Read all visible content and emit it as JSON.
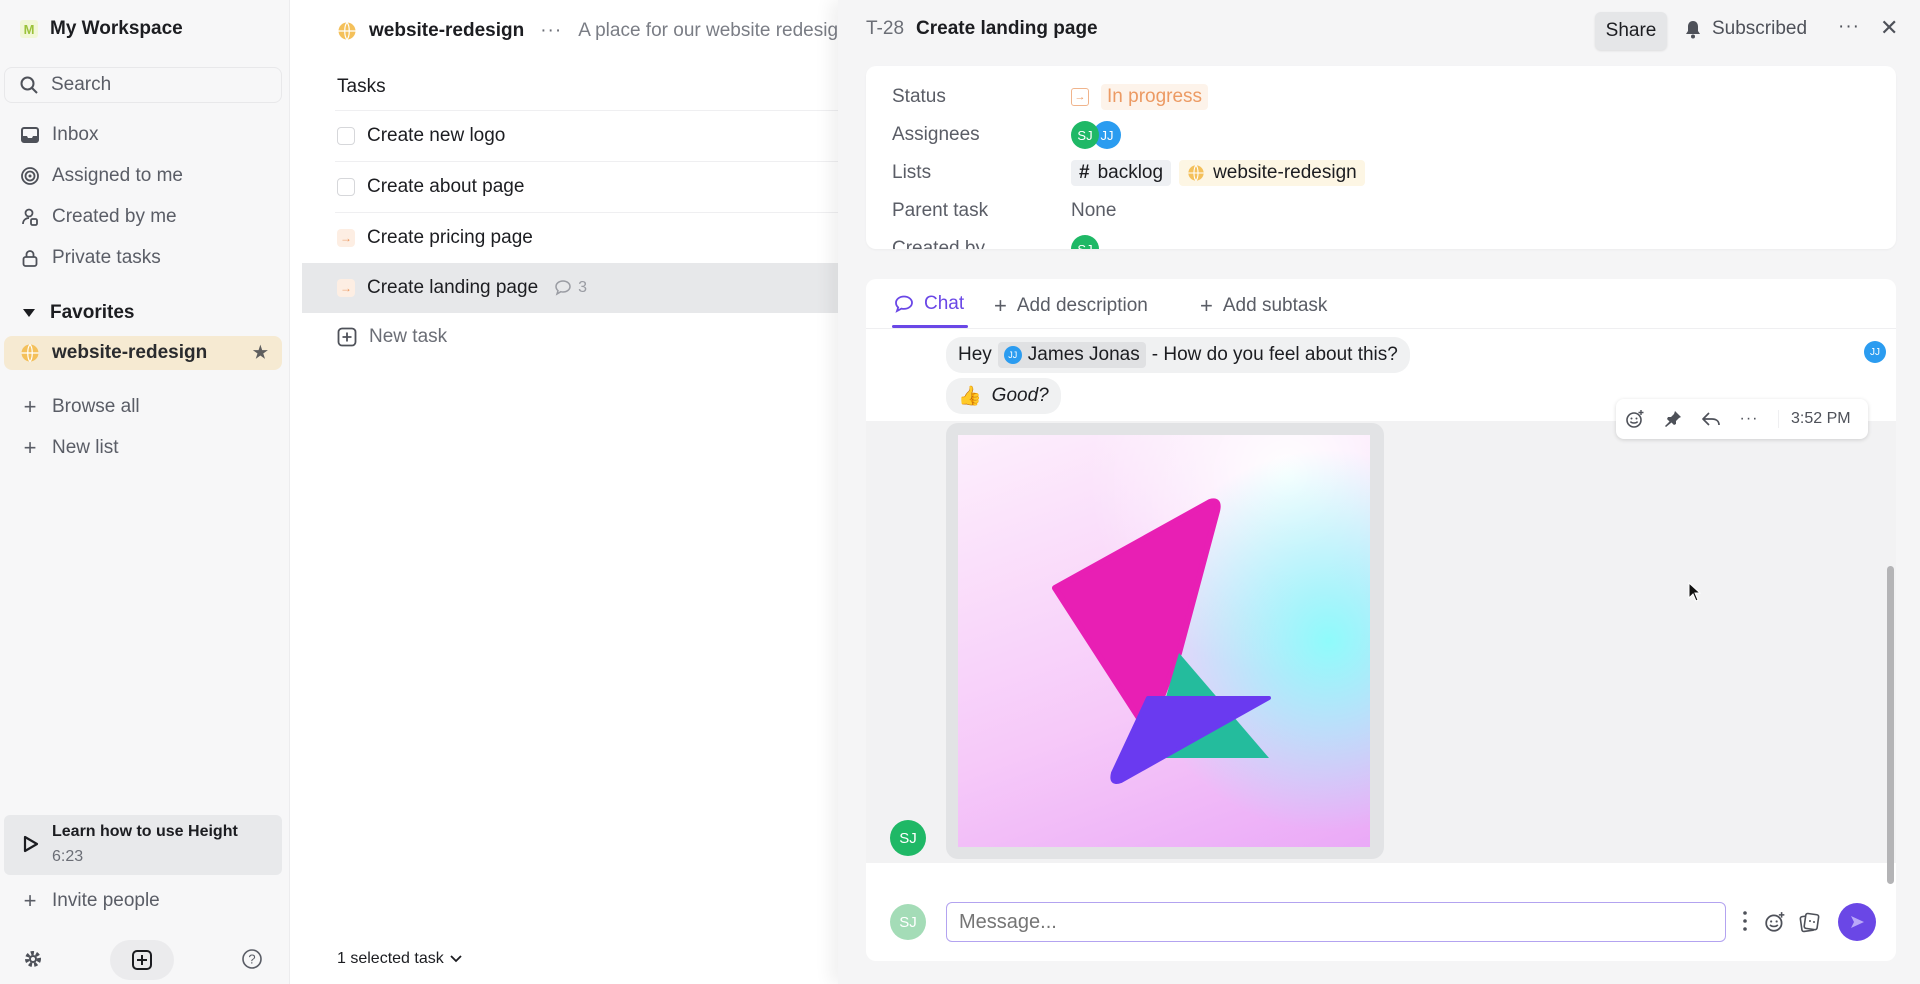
{
  "sidebar": {
    "workspace_initial": "M",
    "workspace_name": "My Workspace",
    "search_label": "Search",
    "nav": [
      {
        "label": "Inbox",
        "icon": "inbox-icon"
      },
      {
        "label": "Assigned to me",
        "icon": "target-icon"
      },
      {
        "label": "Created by me",
        "icon": "user-edit-icon"
      },
      {
        "label": "Private tasks",
        "icon": "lock-icon"
      }
    ],
    "favorites_label": "Favorites",
    "favorite_item": "website-redesign",
    "browse_all": "Browse all",
    "new_list": "New list",
    "learn_title": "Learn how to use Height",
    "learn_duration": "6:23",
    "invite": "Invite people"
  },
  "list": {
    "name": "website-redesign",
    "description": "A place for our website redesign",
    "tasks_header": "Tasks",
    "tasks": [
      {
        "title": "Create new logo",
        "status": "todo"
      },
      {
        "title": "Create about page",
        "status": "todo"
      },
      {
        "title": "Create pricing page",
        "status": "in-progress"
      },
      {
        "title": "Create landing page",
        "status": "in-progress",
        "comments": "3",
        "selected": true
      }
    ],
    "new_task": "New task",
    "selection": "1 selected task"
  },
  "panel": {
    "task_id": "T-28",
    "task_title": "Create landing page",
    "share": "Share",
    "subscribed": "Subscribed",
    "props": {
      "status_label": "Status",
      "status_value": "In progress",
      "assignees_label": "Assignees",
      "assignees": [
        "SJ",
        "JJ"
      ],
      "lists_label": "Lists",
      "lists": [
        "backlog",
        "website-redesign"
      ],
      "parent_label": "Parent task",
      "parent_value": "None",
      "created_label": "Created by",
      "created_by": "SJ"
    },
    "tabs": {
      "chat": "Chat",
      "add_description": "Add description",
      "add_subtask": "Add subtask"
    },
    "messages": {
      "m1_prefix": "Hey",
      "m1_mention": "James Jonas",
      "m1_mention_initials": "JJ",
      "m1_suffix": "- How do you feel about this?",
      "m2_emoji": "👍",
      "m2_text": "Good?",
      "reader_initials": "JJ",
      "author_initials": "SJ",
      "time": "3:52 PM"
    },
    "composer": {
      "avatar": "SJ",
      "placeholder": "Message..."
    }
  },
  "colors": {
    "accent": "#6a47e6",
    "in_progress": "#ec9a63",
    "sj": "#1fb866",
    "jj": "#2b9cf0",
    "favorite_bg": "#f6ead2"
  }
}
